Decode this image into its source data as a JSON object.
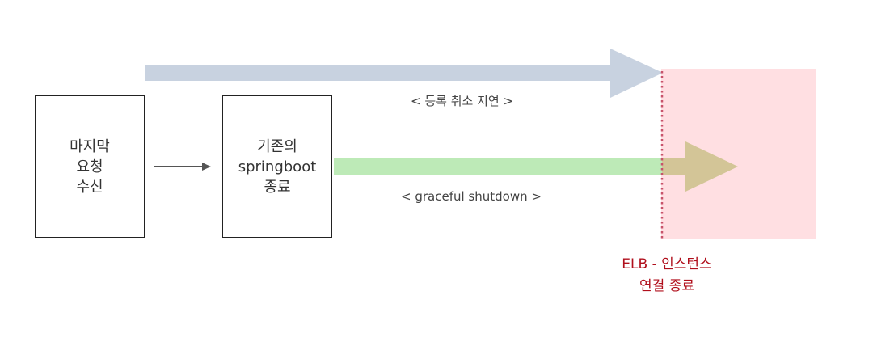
{
  "boxes": {
    "last_request": {
      "lines": [
        "마지막",
        "요청",
        "수신"
      ]
    },
    "old_springboot": {
      "lines": [
        "기존의",
        "springboot",
        "종료"
      ]
    }
  },
  "labels": {
    "deregistration_delay": "< 등록 취소 지연 >",
    "graceful_shutdown": "< graceful shutdown >",
    "elb_termination": [
      "ELB - 인스턴스",
      "연결 종료"
    ]
  },
  "colors": {
    "delay_arrow": "#c8d2e0",
    "graceful_arrow": "#bdeab7",
    "overlap_arrowhead": "#d3c597",
    "termination_zone": "#ffdfe2",
    "termination_line": "#c8536b",
    "elb_text": "#b00f1c",
    "connector_arrow": "#555555"
  }
}
